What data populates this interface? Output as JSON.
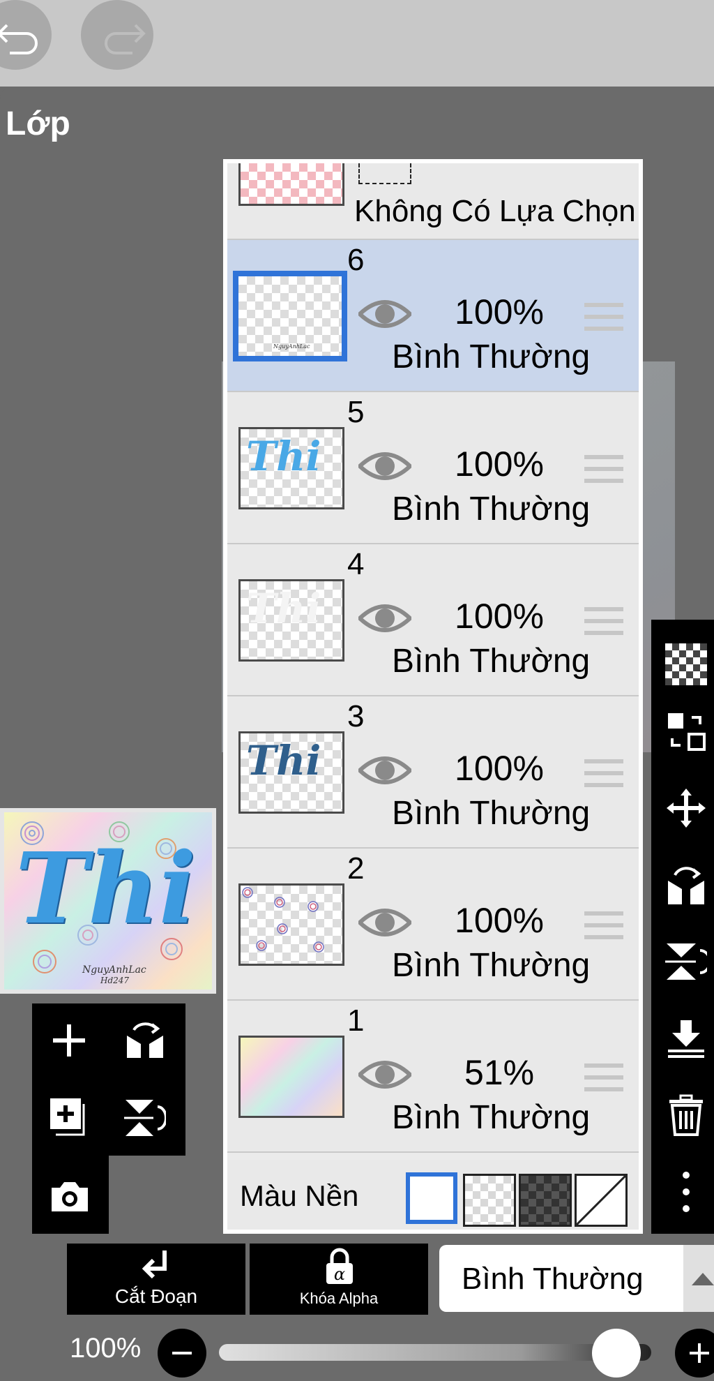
{
  "app": {
    "panel_title": "Lớp"
  },
  "top_partial_layer": {
    "selection_label": "Không Có Lựa Chọn"
  },
  "layers": [
    {
      "number": "6",
      "opacity": "100%",
      "blend": "Bình Thường",
      "selected": true,
      "thumb_mark": "NguyAnhLac"
    },
    {
      "number": "5",
      "opacity": "100%",
      "blend": "Bình Thường",
      "selected": false,
      "thumb_mark": "Thi"
    },
    {
      "number": "4",
      "opacity": "100%",
      "blend": "Bình Thường",
      "selected": false,
      "thumb_mark": "Thi"
    },
    {
      "number": "3",
      "opacity": "100%",
      "blend": "Bình Thường",
      "selected": false,
      "thumb_mark": "Thi"
    },
    {
      "number": "2",
      "opacity": "100%",
      "blend": "Bình Thường",
      "selected": false,
      "thumb_mark": ""
    },
    {
      "number": "1",
      "opacity": "51%",
      "blend": "Bình Thường",
      "selected": false,
      "thumb_mark": ""
    }
  ],
  "background_row": {
    "label": "Màu Nền"
  },
  "preview": {
    "title_art": "Thi",
    "signature": "NguyAnhLac",
    "signature_2": "Hd247"
  },
  "bottom_bar": {
    "clip_label": "Cắt Đoạn",
    "alpha_lock_label": "Khóa Alpha",
    "blend_mode_value": "Bình Thường"
  },
  "zoom": {
    "label": "100%",
    "level": 0.92
  },
  "colors": {
    "selected_row": "#c9d6eb",
    "accent_blue": "#2f73d8",
    "panel_bg": "#ebebeb"
  }
}
